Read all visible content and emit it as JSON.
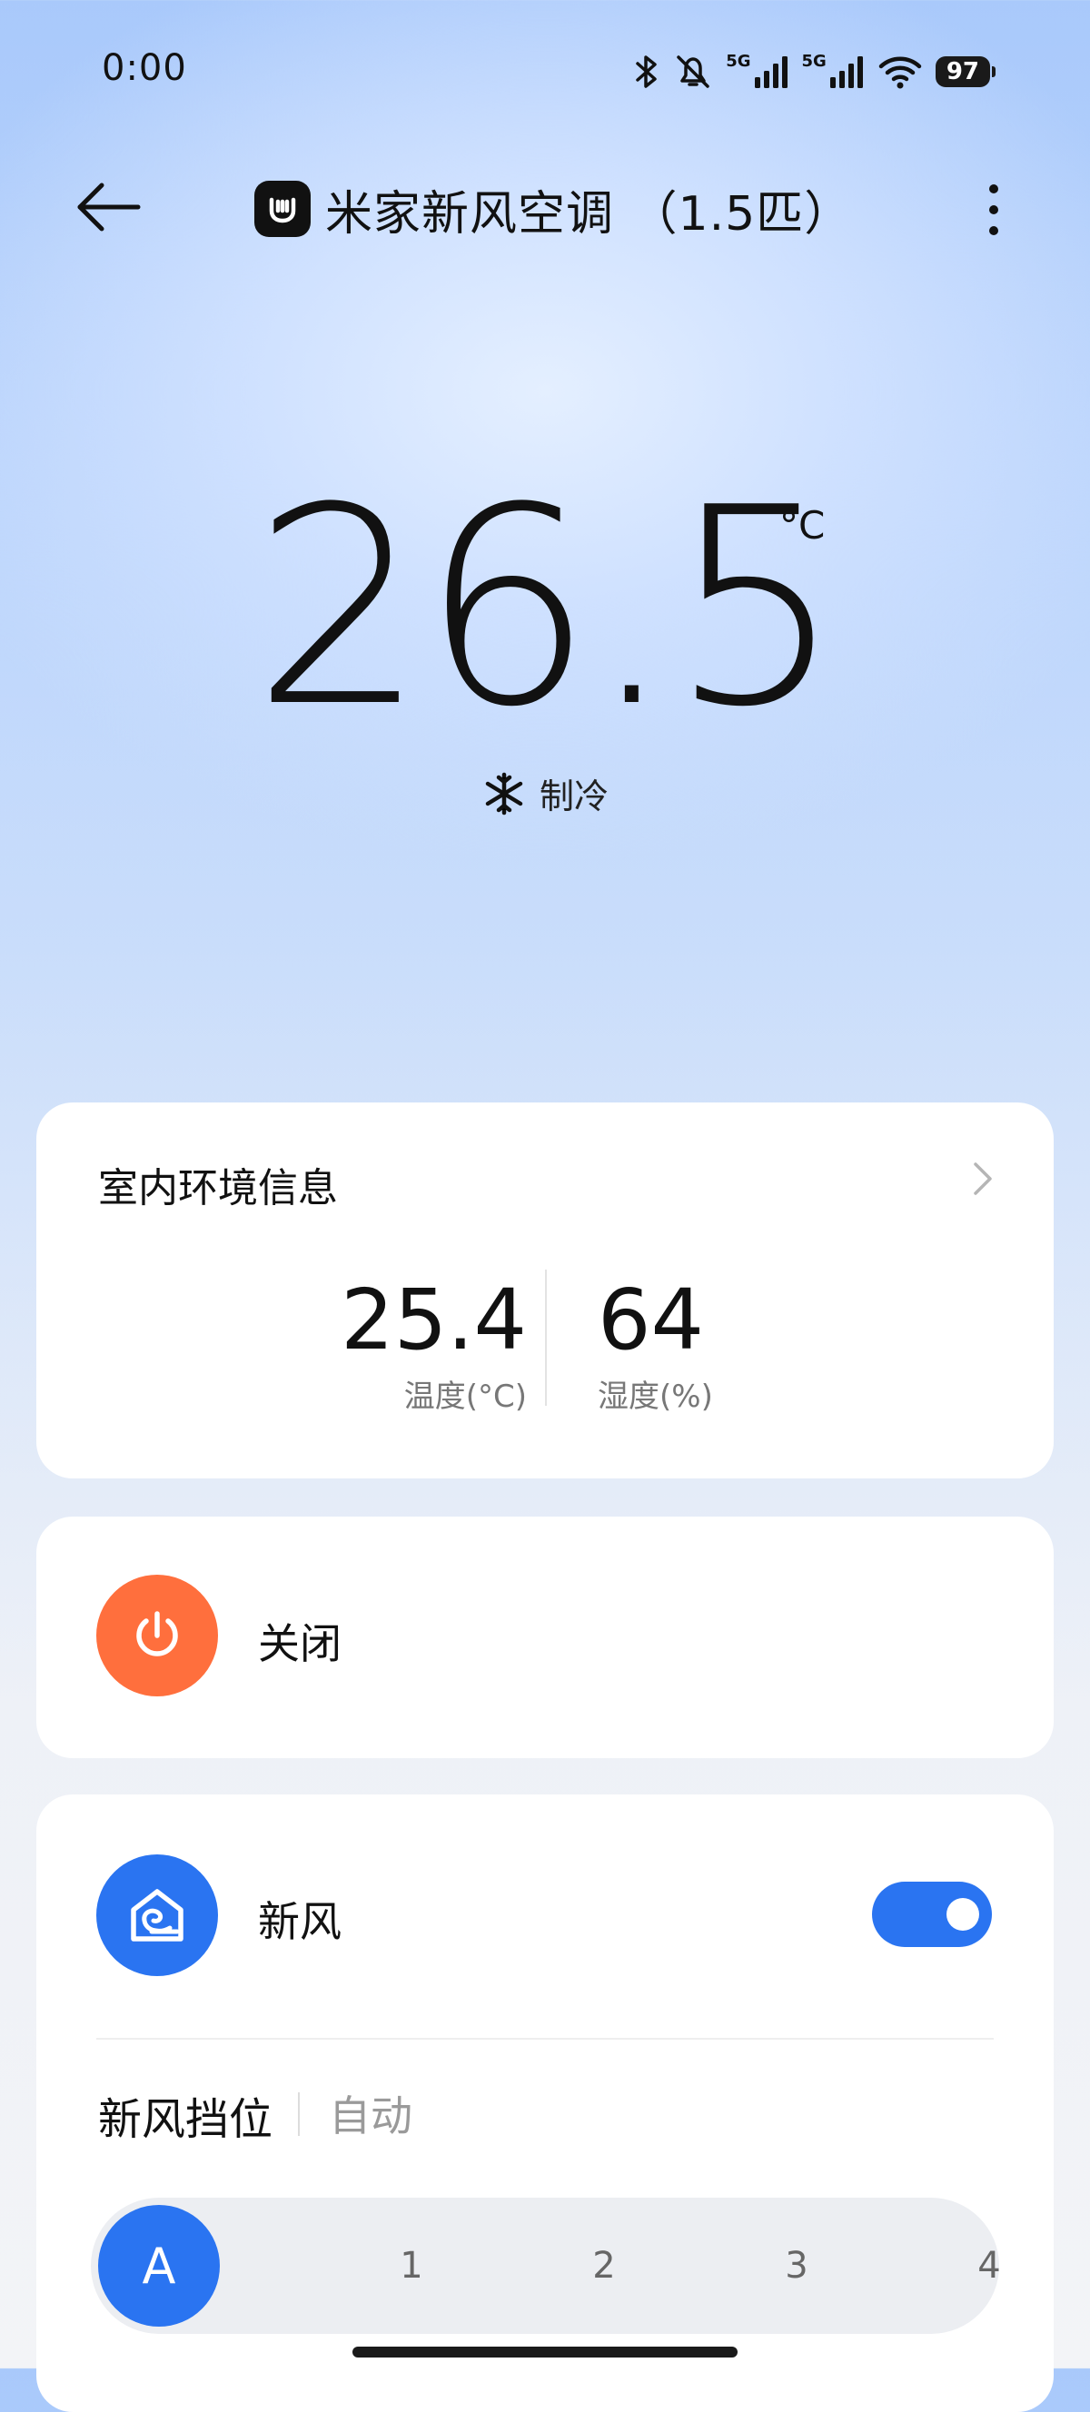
{
  "status_bar": {
    "time": "0:00",
    "network_left": "5G",
    "network_right": "5G",
    "battery": "97",
    "icons": [
      "bluetooth-icon",
      "mute-bell-icon",
      "signal-icon",
      "signal-icon",
      "wifi-icon",
      "battery-icon"
    ]
  },
  "header": {
    "title": "米家新风空调 （1.5匹）",
    "back_icon": "back-arrow-icon",
    "more_icon": "more-vertical-icon"
  },
  "climate": {
    "temperature": "26.5",
    "unit": "°C",
    "mode_label": "制冷",
    "mode_icon": "snowflake-icon"
  },
  "environment": {
    "title": "室内环境信息",
    "temperature_value": "25.4",
    "temperature_label": "温度(°C)",
    "humidity_value": "64",
    "humidity_label": "湿度(%)"
  },
  "power": {
    "label": "关闭",
    "color": "#ff6f3d"
  },
  "fresh_air": {
    "label": "新风",
    "enabled": true,
    "color": "#2a74f1",
    "gear_title": "新风挡位",
    "gear_value": "自动",
    "options": [
      "A",
      "1",
      "2",
      "3",
      "4"
    ],
    "selected": "A"
  }
}
